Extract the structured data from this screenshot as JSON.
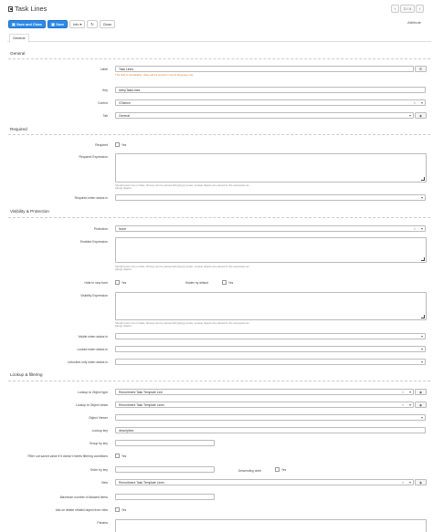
{
  "page": {
    "title": "Task Lines",
    "attribute_label": "Attribute",
    "pager": {
      "prev_icon": "chevron-left-icon",
      "counter": "2 / 4",
      "next_icon": "chevron-right-icon"
    }
  },
  "toolbar": {
    "save_close": "Save and Close",
    "save": "Save",
    "info": "Info",
    "info_caret": "▾",
    "refresh_icon": "refresh-icon",
    "close": "Close"
  },
  "tabs": [
    {
      "label": "General"
    }
  ],
  "sections": {
    "general": "General",
    "required": "Required",
    "visibility": "Visibility & Protection",
    "lookup": "Lookup & filtering"
  },
  "general": {
    "label_label": "Label",
    "label_value": "Task Lines",
    "label_hint": "This field is translatable. Value will be stored in current language only.",
    "key_label": "Key",
    "key_value": "lvtmpTaskLines",
    "control_label": "Control",
    "control_value": "GTablon",
    "tab_label": "Tab",
    "tab_value": "General"
  },
  "required": {
    "required_label": "Required",
    "required_yes": "Yes",
    "expression_label": "Required Expression",
    "expression_hint": "Should return true or false. All keys can be parsed with {{key}} syntax. Lookup objects are parsed for the expression as {{key}} objects.",
    "when_status_label": "Required when status in"
  },
  "visibility": {
    "protection_label": "Protection",
    "protection_value": "None",
    "enabled_expr_label": "Enabled Expression",
    "enabled_expr_hint": "Should return true or false. All keys can be parsed with {{key}} syntax. Lookup objects are parsed for the expression as {{key}} objects.",
    "hide_new_label": "Hide in new form",
    "hide_new_yes": "Yes",
    "hidden_default_label": "Hidden by default",
    "hidden_default_yes": "Yes",
    "visibility_expr_label": "Visibility Expression",
    "visibility_expr_hint": "Should return true or false. All keys can be parsed with {{key}} syntax. Lookup objects are parsed for the expression as {{key}} objects.",
    "visible_status_label": "Visible when status in",
    "locked_status_label": "Locked when status in",
    "unlocked_status_label": "Unlocked only when status in"
  },
  "lookup": {
    "object_type_label": "Lookup to Object type",
    "object_type_value": "Recruitment Task Template Line",
    "object_views_label": "Lookup to Object views",
    "object_views_value": "Recruitment Task Template Lines",
    "object_view_label": "Object Viewer",
    "lookup_key_label": "Lookup key",
    "lookup_key_value": "description",
    "group_by_label": "Group by key",
    "filter_out_label": "Filter out saved value if it doesn't meets filtering conditions",
    "filter_out_yes": "Yes",
    "order_by_label": "Order by key",
    "descending_label": "Descending order",
    "descending_yes": "Yes",
    "view_label": "View",
    "view_value": "Recruitment Task Template Lines",
    "max_items_label": "Maximum number of allowed items",
    "ask_delete_label": "Ask on delete related object from view",
    "ask_delete_yes": "Yes",
    "params_label": "Params"
  },
  "icons": {
    "menu": "list-icon",
    "eye": "eye-icon",
    "clear": "×"
  },
  "colors": {
    "primary": "#2c8ae8",
    "hint_orange": "#d9822b"
  }
}
